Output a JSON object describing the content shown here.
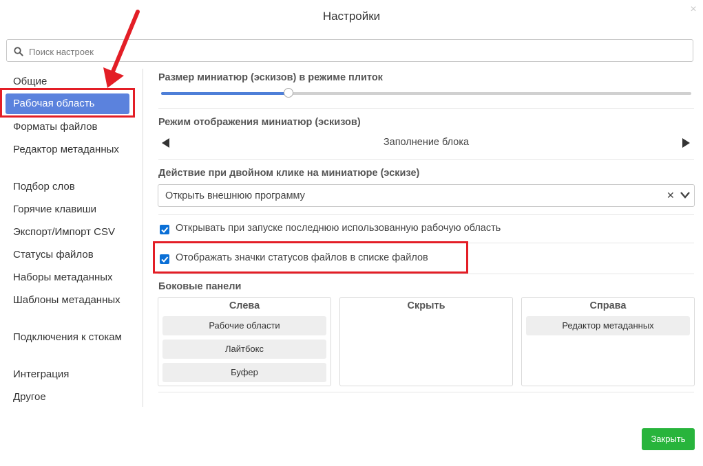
{
  "dialog": {
    "title": "Настройки",
    "close_icon": "×"
  },
  "search": {
    "placeholder": "Поиск настроек",
    "value": ""
  },
  "sidebar": {
    "items": [
      {
        "label": "Общие"
      },
      {
        "label": "Рабочая область",
        "active": true
      },
      {
        "label": "Форматы файлов"
      },
      {
        "label": "Редактор метаданных"
      },
      {
        "label": "Подбор слов"
      },
      {
        "label": "Горячие клавиши"
      },
      {
        "label": "Экспорт/Импорт CSV"
      },
      {
        "label": "Статусы файлов"
      },
      {
        "label": "Наборы метаданных"
      },
      {
        "label": "Шаблоны метаданных"
      },
      {
        "label": "Подключения к стокам"
      },
      {
        "label": "Интеграция"
      },
      {
        "label": "Другое"
      }
    ]
  },
  "settings": {
    "thumb_size": {
      "label": "Размер миниатюр (эскизов) в режиме плиток",
      "value_fraction": 0.24
    },
    "thumb_mode": {
      "label": "Режим отображения миниатюр (эскизов)",
      "value": "Заполнение блока"
    },
    "double_click": {
      "label": "Действие при двойном клике на миниатюре (эскизе)",
      "value": "Открыть внешнюю программу",
      "clear_icon": "✕"
    },
    "open_last_workspace": {
      "label": "Открывать при запуске последнюю использованную рабочую область",
      "checked": true
    },
    "show_status_icons": {
      "label": "Отображать значки статусов файлов в списке файлов",
      "checked": true
    }
  },
  "side_panels": {
    "label": "Боковые панели",
    "left": {
      "title": "Слева",
      "items": [
        "Рабочие области",
        "Лайтбокс",
        "Буфер"
      ]
    },
    "hide": {
      "title": "Скрыть",
      "items": []
    },
    "right": {
      "title": "Справа",
      "items": [
        "Редактор метаданных"
      ]
    }
  },
  "footer": {
    "close_label": "Закрыть"
  },
  "colors": {
    "accent": "#5b82dd",
    "highlight": "#e31e26",
    "close_button": "#28b43c",
    "checkbox": "#0a6fd6"
  }
}
